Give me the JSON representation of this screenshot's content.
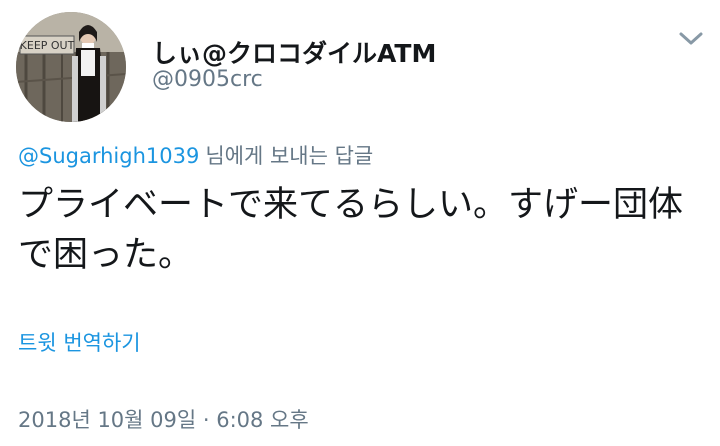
{
  "user": {
    "display_name": "しぃ@クロコダイルATM",
    "handle": "@0905crc",
    "avatar_sign_text": "KEEP OUT"
  },
  "reply": {
    "mention": "@Sugarhigh1039",
    "suffix": "님에게 보내는 답글"
  },
  "tweet": {
    "line1": "プライベートで来てるらしい。すげー団体",
    "line2": "で困った。"
  },
  "translate_label": "트윗 번역하기",
  "timestamp": "2018년 10월 09일 · 6:08 오후",
  "icons": {
    "menu": "chevron-down-icon"
  },
  "colors": {
    "link": "#1b95e0",
    "secondary_text": "#657786",
    "primary_text": "#14171a"
  }
}
